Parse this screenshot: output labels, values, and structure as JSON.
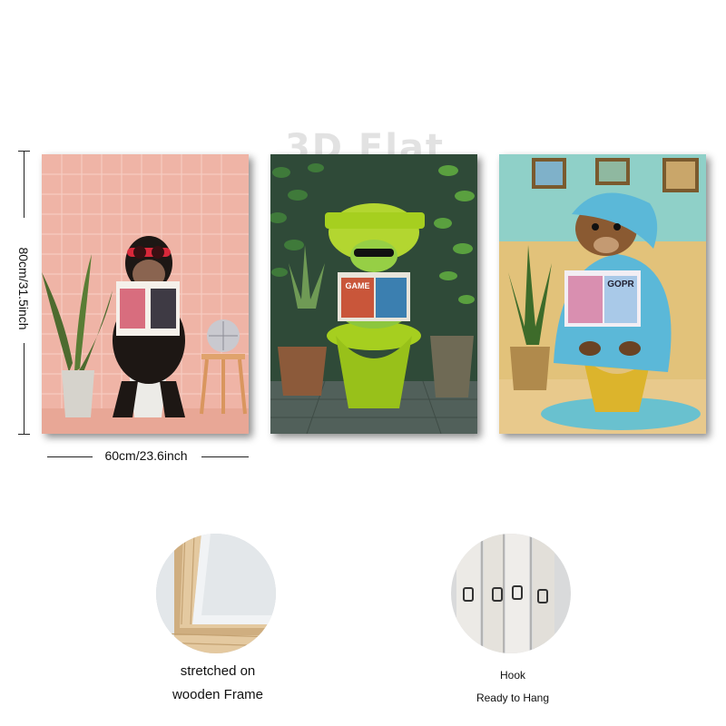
{
  "watermark": "3D Flat",
  "dimensions": {
    "height_label": "80cm/31.5inch",
    "width_label": "60cm/23.6inch"
  },
  "panels": [
    {
      "subject": "chimpanzee-on-toilet",
      "magazine_title": ""
    },
    {
      "subject": "frog-on-toilet",
      "magazine_title": "GAME"
    },
    {
      "subject": "beaver-on-toilet",
      "magazine_title": "GOPR"
    }
  ],
  "details": {
    "frame": {
      "line1": "stretched on",
      "line2": "wooden Frame"
    },
    "hook": {
      "line1": "Hook",
      "line2": "Ready to Hang"
    }
  },
  "colors": {
    "pink_wall": "#efb4a6",
    "green_wall": "#2f4a38",
    "teal_wall": "#8fd0c8",
    "lime_toilet": "#a6cf1f",
    "yellow_toilet": "#e8c23a",
    "towel_blue": "#5bb8d8"
  }
}
